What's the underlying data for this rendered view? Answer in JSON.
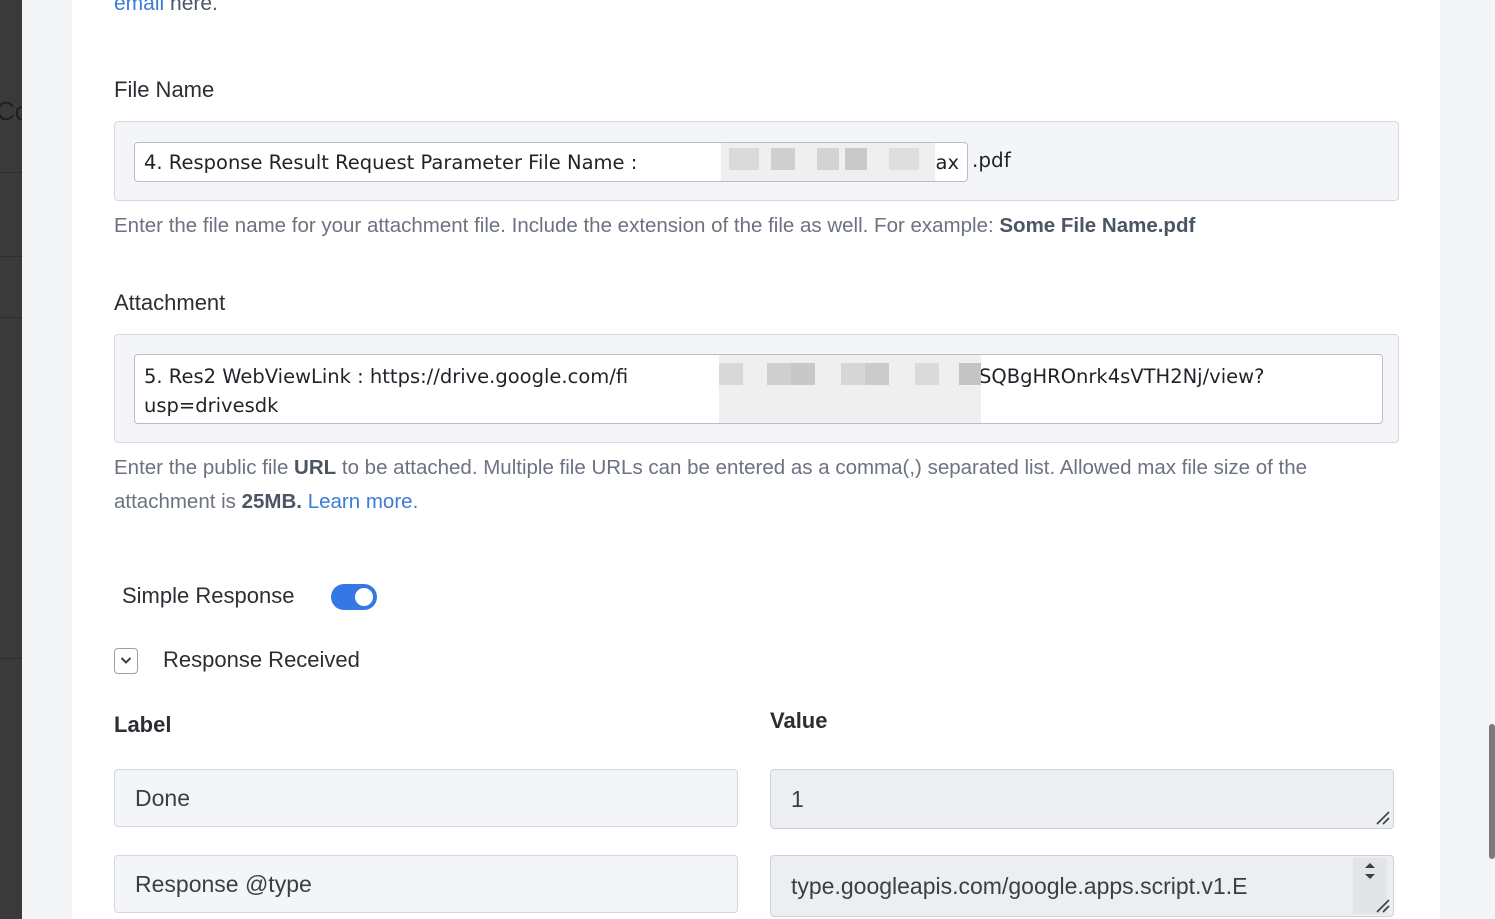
{
  "background": {
    "partial_text": "Co"
  },
  "top": {
    "link": "email",
    "rest": " here."
  },
  "file_name": {
    "label": "File Name",
    "chip_text": "4. Response Result Request Parameter File Name :",
    "chip_tail": "ax",
    "suffix": ".pdf",
    "help_prefix": "Enter the file name for your attachment file. Include the extension of the file as well. For example: ",
    "help_example": "Some File Name.pdf"
  },
  "attachment": {
    "label": "Attachment",
    "chip_line1_start": "5. Res2 WebViewLink : https://drive.google.com/fi",
    "chip_line1_end": "SQBgHROnrk4sVTH2Nj/view?",
    "chip_line2": "usp=drivesdk",
    "help_1": "Enter the public file ",
    "help_url": "URL",
    "help_2": " to be attached. Multiple file URLs can be entered as a comma(,) separated list. Allowed max file size of the attachment is ",
    "help_size": "25MB.",
    "help_space": " ",
    "help_link": "Learn more",
    "help_end": "."
  },
  "simple_response": {
    "label": "Simple Response",
    "enabled": true
  },
  "response_received": {
    "label": "Response Received",
    "expanded": true
  },
  "table": {
    "label_header": "Label",
    "value_header": "Value",
    "rows": [
      {
        "label": "Done",
        "value": "1"
      },
      {
        "label": "Response @type",
        "value": "type.googleapis.com/google.apps.script.v1.E"
      }
    ]
  },
  "colors": {
    "accent": "#3578e5",
    "link": "#3c7bd6"
  }
}
